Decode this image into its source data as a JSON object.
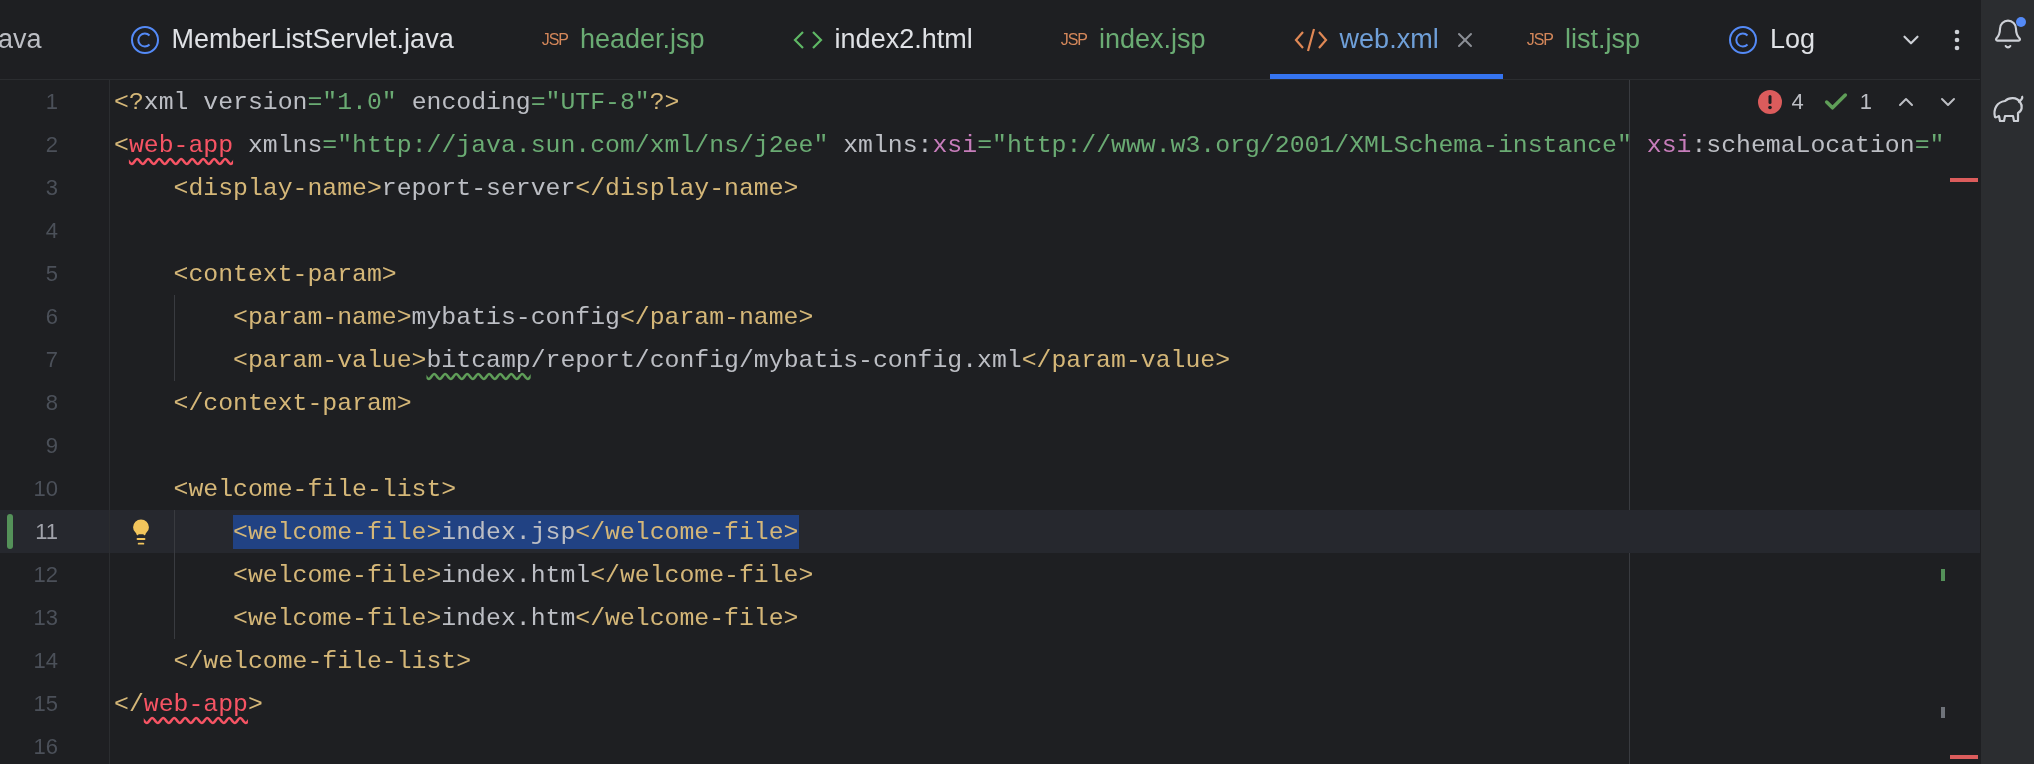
{
  "tabs": [
    {
      "label": "ava",
      "color": "#bcbec4",
      "selected": false
    },
    {
      "label": "MemberListServlet.java",
      "kind": "class",
      "color": "#dfe1e5",
      "selected": false
    },
    {
      "label": "header.jsp",
      "kind": "jsp",
      "badge": "JSP",
      "color": "#6aab73",
      "selected": false
    },
    {
      "label": "index2.html",
      "kind": "html",
      "color": "#dfe1e5",
      "selected": false
    },
    {
      "label": "index.jsp",
      "kind": "jsp",
      "badge": "JSP",
      "color": "#6aab73",
      "selected": false
    },
    {
      "label": "web.xml",
      "kind": "xml",
      "color": "#6f9fd8",
      "selected": true
    },
    {
      "label": "list.jsp",
      "kind": "jsp",
      "badge": "JSP",
      "color": "#6aab73",
      "selected": false
    },
    {
      "label": "Log",
      "kind": "class",
      "color": "#dfe1e5",
      "selected": false
    }
  ],
  "inspections": {
    "errors": "4",
    "warnings": "1"
  },
  "lines": [
    {
      "number": "1",
      "current": false,
      "selected": false,
      "intention": false,
      "changed": false,
      "tokens": [
        {
          "kind": "tag",
          "text": "<?"
        },
        {
          "kind": "text",
          "text": "xml version"
        },
        {
          "kind": "value",
          "text": "=\"1.0\""
        },
        {
          "kind": "text",
          "text": " encoding"
        },
        {
          "kind": "value",
          "text": "=\"UTF-8\""
        },
        {
          "kind": "tag",
          "text": "?>"
        }
      ]
    },
    {
      "number": "2",
      "current": false,
      "selected": false,
      "intention": false,
      "changed": false,
      "tokens": [
        {
          "kind": "tag",
          "text": "<"
        },
        {
          "kind": "error",
          "text": "web-app"
        },
        {
          "kind": "text",
          "text": " xmlns"
        },
        {
          "kind": "value",
          "text": "=\"http://java.sun.com/xml/ns/j2ee\""
        },
        {
          "kind": "text",
          "text": " xmlns:"
        },
        {
          "kind": "ns",
          "text": "xsi"
        },
        {
          "kind": "value",
          "text": "=\"http://www.w3.org/2001/XMLSchema-instance\""
        },
        {
          "kind": "ns",
          "text": " xsi"
        },
        {
          "kind": "text",
          "text": ":schemaLocation"
        },
        {
          "kind": "value",
          "text": "=\""
        }
      ]
    },
    {
      "number": "3",
      "current": false,
      "selected": false,
      "intention": false,
      "changed": false,
      "tokens": [
        {
          "kind": "indent"
        },
        {
          "kind": "tag",
          "text": "<display-name>"
        },
        {
          "kind": "text",
          "text": "report-server"
        },
        {
          "kind": "tag",
          "text": "</display-name>"
        }
      ]
    },
    {
      "number": "4",
      "current": false,
      "selected": false,
      "intention": false,
      "changed": false
    },
    {
      "number": "5",
      "current": false,
      "selected": false,
      "intention": false,
      "changed": false,
      "tokens": [
        {
          "kind": "indent"
        },
        {
          "kind": "tag",
          "text": "<context-param>"
        }
      ]
    },
    {
      "number": "6",
      "current": false,
      "selected": false,
      "intention": false,
      "changed": false,
      "tokens": [
        {
          "kind": "indent"
        },
        {
          "kind": "indent"
        },
        {
          "kind": "tag",
          "text": "<param-name>"
        },
        {
          "kind": "text",
          "text": "mybatis-config"
        },
        {
          "kind": "tag",
          "text": "</param-name>"
        }
      ]
    },
    {
      "number": "7",
      "current": false,
      "selected": false,
      "intention": false,
      "changed": false,
      "tokens": [
        {
          "kind": "indent"
        },
        {
          "kind": "indent"
        },
        {
          "kind": "tag",
          "text": "<param-value>"
        },
        {
          "kind": "typo",
          "text": "bitcamp"
        },
        {
          "kind": "text",
          "text": "/report/config/mybatis-config.xml"
        },
        {
          "kind": "tag",
          "text": "</param-value>"
        }
      ]
    },
    {
      "number": "8",
      "current": false,
      "selected": false,
      "intention": false,
      "changed": false,
      "tokens": [
        {
          "kind": "indent"
        },
        {
          "kind": "tag",
          "text": "</context-param>"
        }
      ]
    },
    {
      "number": "9",
      "current": false,
      "selected": false,
      "intention": false,
      "changed": false
    },
    {
      "number": "10",
      "current": false,
      "selected": false,
      "intention": false,
      "changed": false,
      "tokens": [
        {
          "kind": "indent"
        },
        {
          "kind": "tag",
          "text": "<welcome-file-list>"
        }
      ]
    },
    {
      "number": "11",
      "current": true,
      "selected": true,
      "intention": true,
      "changed": true,
      "tokens": [
        {
          "kind": "indent"
        },
        {
          "kind": "indent"
        },
        {
          "kind": "tag",
          "text": "<welcome-file>"
        },
        {
          "kind": "text",
          "text": "index.jsp"
        },
        {
          "kind": "tag",
          "text": "</welcome-file>"
        }
      ]
    },
    {
      "number": "12",
      "current": false,
      "selected": false,
      "intention": false,
      "changed": false,
      "tokens": [
        {
          "kind": "indent"
        },
        {
          "kind": "indent"
        },
        {
          "kind": "tag",
          "text": "<welcome-file>"
        },
        {
          "kind": "text",
          "text": "index.html"
        },
        {
          "kind": "tag",
          "text": "</welcome-file>"
        }
      ]
    },
    {
      "number": "13",
      "current": false,
      "selected": false,
      "intention": false,
      "changed": false,
      "tokens": [
        {
          "kind": "indent"
        },
        {
          "kind": "indent"
        },
        {
          "kind": "tag",
          "text": "<welcome-file>"
        },
        {
          "kind": "text",
          "text": "index.htm"
        },
        {
          "kind": "tag",
          "text": "</welcome-file>"
        }
      ]
    },
    {
      "number": "14",
      "current": false,
      "selected": false,
      "intention": false,
      "changed": false,
      "tokens": [
        {
          "kind": "indent"
        },
        {
          "kind": "tag",
          "text": "</welcome-file-list>"
        }
      ]
    },
    {
      "number": "15",
      "current": false,
      "selected": false,
      "intention": false,
      "changed": false,
      "tokens": [
        {
          "kind": "tag",
          "text": "</"
        },
        {
          "kind": "error",
          "text": "web-app"
        },
        {
          "kind": "tag",
          "text": ">"
        }
      ]
    },
    {
      "number": "16",
      "current": false,
      "selected": false,
      "intention": false,
      "changed": false
    }
  ]
}
